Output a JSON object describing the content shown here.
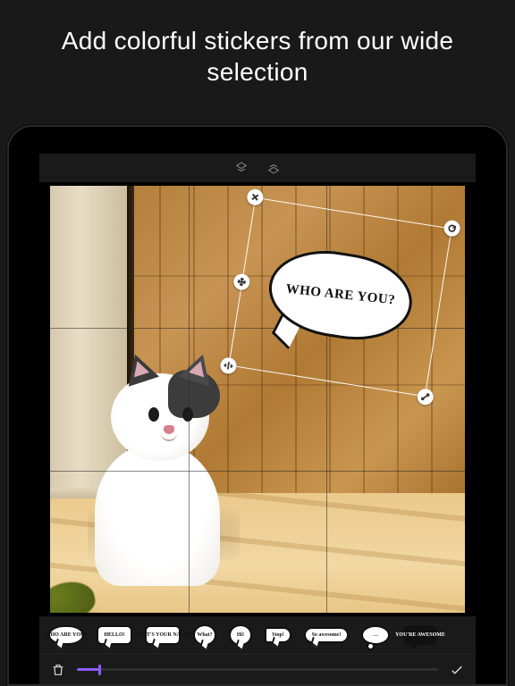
{
  "promo": {
    "title": "Add colorful stickers from our wide selection"
  },
  "topbar": {
    "layer_up_icon": "layer-up-icon",
    "layer_down_icon": "layer-down-icon"
  },
  "sticker": {
    "text": "WHO ARE YOU?"
  },
  "handles": {
    "tl_icon": "close-icon",
    "tr_icon": "rotate-icon",
    "bl_icon": "flip-icon",
    "br_icon": "scale-icon",
    "ml_icon": "move-icon"
  },
  "tray_items": [
    {
      "shape": "oval",
      "label": "WHO ARE YOU?"
    },
    {
      "shape": "rect",
      "label": "HELLO!"
    },
    {
      "shape": "rect",
      "label": "WHAT'S YOUR NAME?"
    },
    {
      "shape": "round",
      "label": "What?"
    },
    {
      "shape": "round",
      "label": "Hi!"
    },
    {
      "shape": "tag",
      "label": "Stop!"
    },
    {
      "shape": "long",
      "label": "So awesome!"
    },
    {
      "shape": "cloud",
      "label": "…"
    },
    {
      "shape": "dark",
      "label": "YOU'RE AWESOME"
    }
  ],
  "bottombar": {
    "delete_icon": "trash-icon",
    "confirm_icon": "check-icon"
  },
  "colors": {
    "accent": "#8e5cff"
  }
}
